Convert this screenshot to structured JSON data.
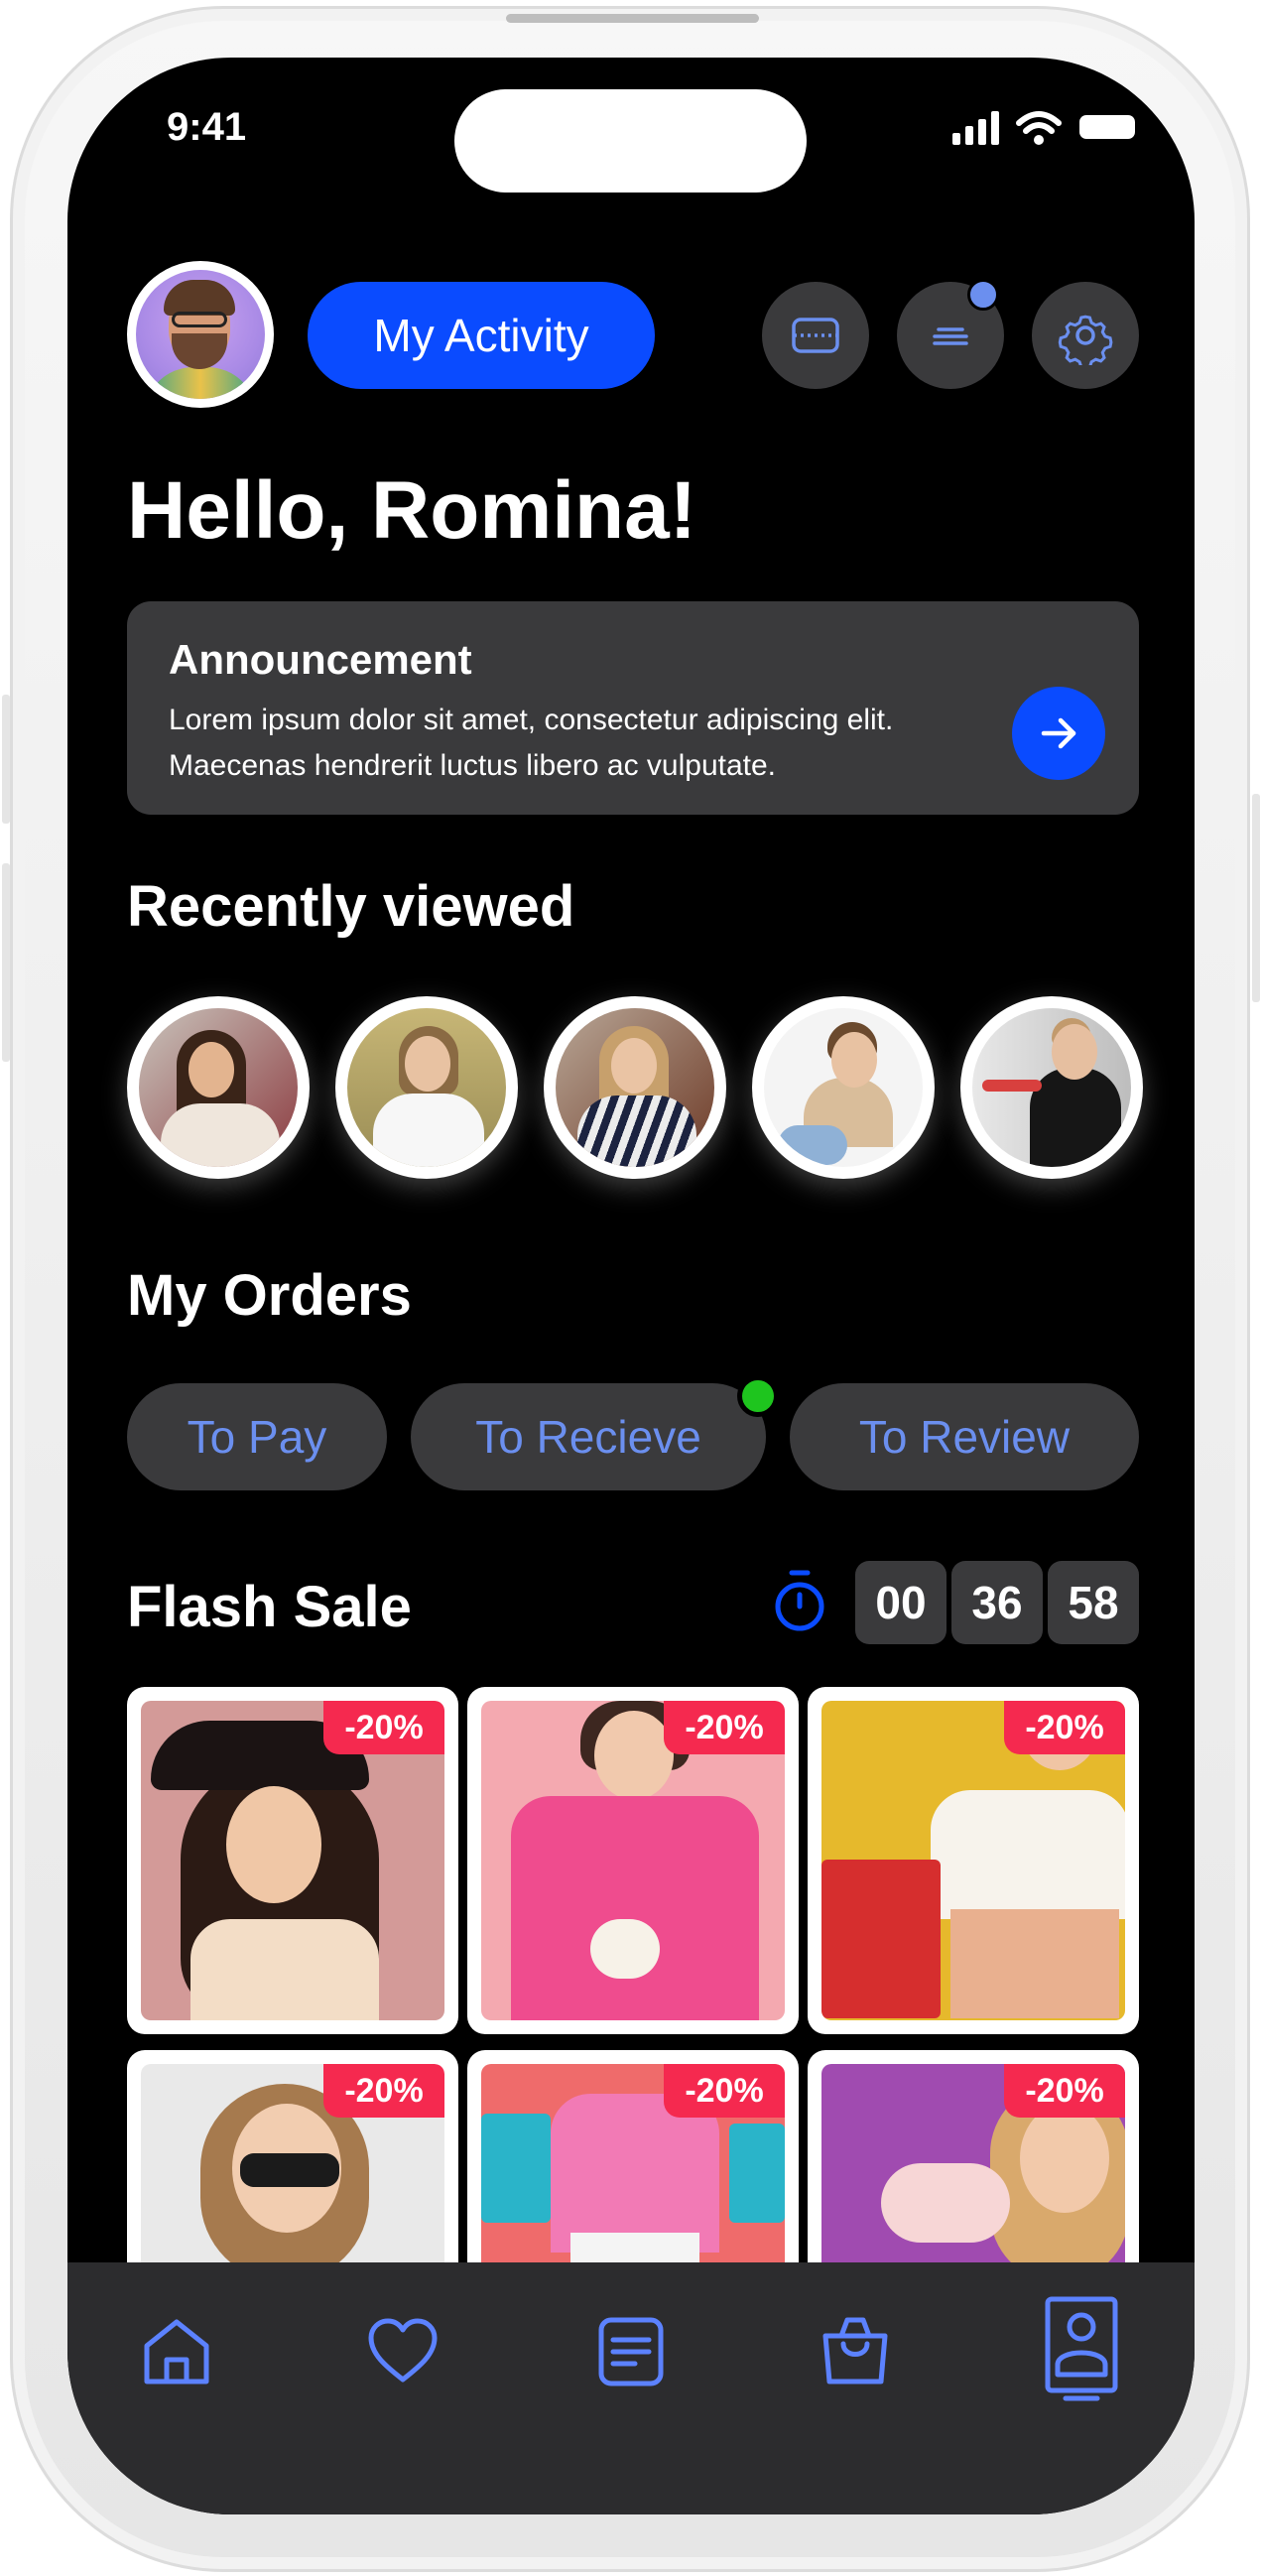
{
  "status_bar": {
    "time": "9:41"
  },
  "header": {
    "activity_label": "My Activity"
  },
  "greeting": "Hello, Romina!",
  "announcement": {
    "title": "Announcement",
    "text": "Lorem ipsum dolor sit amet, consectetur adipiscing elit. Maecenas hendrerit luctus libero ac vulputate."
  },
  "recently_viewed": {
    "title": "Recently viewed"
  },
  "orders": {
    "title": "My Orders",
    "tabs": [
      "To Pay",
      "To Recieve",
      "To Review"
    ]
  },
  "flash_sale": {
    "title": "Flash Sale",
    "timer": [
      "00",
      "36",
      "58"
    ],
    "products": [
      {
        "discount": "-20%"
      },
      {
        "discount": "-20%"
      },
      {
        "discount": "-20%"
      },
      {
        "discount": "-20%"
      },
      {
        "discount": "-20%"
      },
      {
        "discount": "-20%"
      }
    ]
  },
  "tab_bar": {
    "items": [
      "home-icon",
      "heart-icon",
      "list-icon",
      "bag-icon",
      "profile-icon"
    ]
  },
  "colors": {
    "accent": "#0a4bff",
    "secondary": "#6b8fef",
    "badge": "#f5294f",
    "surface": "#3a3a3c",
    "online": "#1ec51e"
  }
}
